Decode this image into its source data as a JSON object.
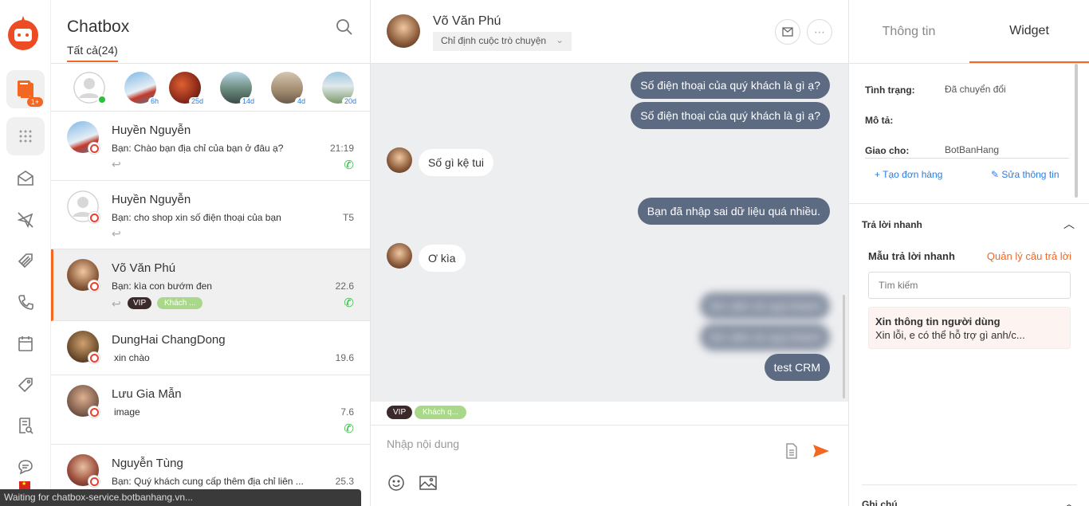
{
  "nav": {
    "badge": "1+"
  },
  "list": {
    "title": "Chatbox",
    "filter": "Tất cả(24)",
    "stories": [
      {
        "badge": ""
      },
      {
        "badge": "6h"
      },
      {
        "badge": "25d"
      },
      {
        "badge": "14d"
      },
      {
        "badge": "4d"
      },
      {
        "badge": "20d"
      }
    ],
    "conversations": [
      {
        "name": "Huyền Nguyễn",
        "msg": "Bạn: Chào bạn địa chỉ của bạn ở đâu ạ?",
        "time": "21:19"
      },
      {
        "name": "Huyền Nguyễn",
        "msg": "Bạn: cho shop xin số điện thoại của bạn",
        "time": "T5"
      },
      {
        "name": "Võ Văn Phú",
        "msg": "Bạn: kìa con bướm đen",
        "time": "22.6",
        "tag1": "VIP",
        "tag2": "Khách ..."
      },
      {
        "name": "DungHai ChangDong",
        "msg": "xin chào",
        "time": "19.6"
      },
      {
        "name": "Lưu Gia Mẫn",
        "msg": "image",
        "time": "7.6"
      },
      {
        "name": "Nguyễn Tùng",
        "msg": "Bạn: Quý khách cung cấp thêm địa chỉ liên ...",
        "time": "25.3"
      }
    ]
  },
  "status_bar": "Waiting for chatbox-service.botbanhang.vn...",
  "chat": {
    "name": "Võ Văn Phú",
    "assign": "Chỉ định cuộc trò chuyện",
    "messages": {
      "m1": "Số điện thoại của quý khách là gì ạ?",
      "m2": "Số điện thoại của quý khách là gì ạ?",
      "m3": "Số gì kệ tui",
      "m4": "Bạn đã nhập sai dữ liệu quá nhiều.",
      "m5": "Ơ kìa",
      "m6": "Xin cảm ơn quý khách",
      "m7": "Xin cảm ơn quý khách",
      "m8": "test CRM"
    },
    "tags": {
      "vip": "VIP",
      "kh": "Khách q..."
    },
    "input_placeholder": "Nhập nội dung"
  },
  "panel": {
    "tabs": [
      "Thông tin",
      "Widget"
    ],
    "status_label": "Tình trạng:",
    "status_value": "Đã chuyển đổi",
    "desc_label": "Mô tả:",
    "assign_label": "Giao cho:",
    "assign_value": "BotBanHang",
    "create_order": "Tạo đơn hàng",
    "edit_info": "Sửa thông tin",
    "quick_reply": "Trả lời nhanh",
    "template_title": "Mẫu trả lời nhanh",
    "manage": "Quản lý câu trả lời",
    "search_placeholder": "Tìm kiếm",
    "card_title": "Xin thông tin người dùng",
    "card_body": "Xin lỗi, e có thể hỗ trợ gì anh/c...",
    "notes": "Ghi chú"
  }
}
